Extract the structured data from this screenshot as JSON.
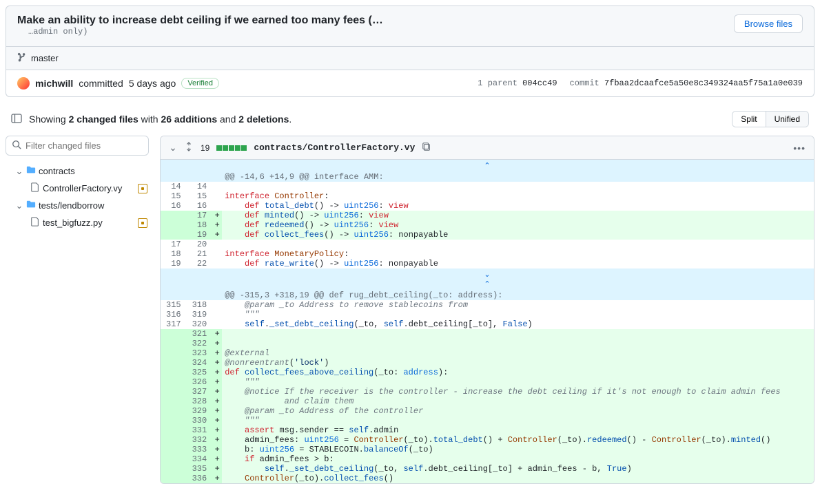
{
  "header": {
    "title": "Make an ability to increase debt ceiling if we earned too many fees (…",
    "subtitle": "…admin only)",
    "browse_files_label": "Browse files"
  },
  "branch": {
    "name": "master"
  },
  "commit": {
    "author": "michwill",
    "action": "committed",
    "when": "5 days ago",
    "verified_label": "Verified",
    "parent_count_label": "1 parent",
    "parent_sha": "004cc49",
    "commit_label": "commit",
    "commit_sha": "7fbaa2dcaafce5a50e8c349324aa5f75a1a0e039"
  },
  "stats": {
    "prefix": "Showing ",
    "files": "2 changed files",
    "with": " with ",
    "additions": "26 additions",
    "and": " and ",
    "deletions": "2 deletions",
    "suffix": "."
  },
  "view_toggle": {
    "split": "Split",
    "unified": "Unified"
  },
  "filter": {
    "placeholder": "Filter changed files"
  },
  "tree": {
    "folder1": "contracts",
    "file1": "ControllerFactory.vy",
    "folder2": "tests/lendborrow",
    "file2": "test_bigfuzz.py"
  },
  "file": {
    "count": "19",
    "name": "contracts/ControllerFactory.vy"
  },
  "diff_lines": [
    {
      "type": "expand-up"
    },
    {
      "type": "hunk",
      "old": "",
      "new": "",
      "text": "@@ -14,6 +14,9 @@ interface AMM:"
    },
    {
      "type": "ctx",
      "old": "14",
      "new": "14",
      "text": ""
    },
    {
      "type": "ctx",
      "old": "15",
      "new": "15",
      "html": "<span class='tok-k'>interface</span> <span class='tok-id'>Controller</span>:"
    },
    {
      "type": "ctx",
      "old": "16",
      "new": "16",
      "html": "    <span class='tok-k'>def</span> <span class='tok-fn'>total_debt</span>() -> <span class='tok-t'>uint256</span>: <span class='tok-k'>view</span>"
    },
    {
      "type": "add",
      "old": "",
      "new": "17",
      "html": "    <span class='tok-k'>def</span> <span class='tok-fn'>minted</span>() -> <span class='tok-t'>uint256</span>: <span class='tok-k'>view</span>"
    },
    {
      "type": "add",
      "old": "",
      "new": "18",
      "html": "    <span class='tok-k'>def</span> <span class='tok-fn'>redeemed</span>() -> <span class='tok-t'>uint256</span>: <span class='tok-k'>view</span>"
    },
    {
      "type": "add",
      "old": "",
      "new": "19",
      "html": "    <span class='tok-k'>def</span> <span class='tok-fn'>collect_fees</span>() -> <span class='tok-t'>uint256</span>: nonpayable"
    },
    {
      "type": "ctx",
      "old": "17",
      "new": "20",
      "text": ""
    },
    {
      "type": "ctx",
      "old": "18",
      "new": "21",
      "html": "<span class='tok-k'>interface</span> <span class='tok-id'>MonetaryPolicy</span>:"
    },
    {
      "type": "ctx",
      "old": "19",
      "new": "22",
      "html": "    <span class='tok-k'>def</span> <span class='tok-fn'>rate_write</span>() -> <span class='tok-t'>uint256</span>: nonpayable"
    },
    {
      "type": "expand-both"
    },
    {
      "type": "hunk",
      "old": "",
      "new": "",
      "text": "@@ -315,3 +318,19 @@ def rug_debt_ceiling(_to: address):"
    },
    {
      "type": "ctx",
      "old": "315",
      "new": "318",
      "html": "    <span class='tok-c'>@param _to Address to remove stablecoins from</span>"
    },
    {
      "type": "ctx",
      "old": "316",
      "new": "319",
      "html": "    <span class='tok-c'>\"\"\"</span>"
    },
    {
      "type": "ctx",
      "old": "317",
      "new": "320",
      "html": "    <span class='tok-b'>self</span>.<span class='tok-fn'>_set_debt_ceiling</span>(_to, <span class='tok-b'>self</span>.debt_ceiling[_to], <span class='tok-b'>False</span>)"
    },
    {
      "type": "add",
      "old": "",
      "new": "321",
      "text": ""
    },
    {
      "type": "add",
      "old": "",
      "new": "322",
      "text": ""
    },
    {
      "type": "add",
      "old": "",
      "new": "323",
      "html": "<span class='tok-c'>@external</span>"
    },
    {
      "type": "add",
      "old": "",
      "new": "324",
      "html": "<span class='tok-c'>@nonreentrant</span>(<span class='tok-s'>'lock'</span>)"
    },
    {
      "type": "add",
      "old": "",
      "new": "325",
      "html": "<span class='tok-k'>def</span> <span class='tok-fn'>collect_fees_above_ceiling</span>(_to: <span class='tok-t'>address</span>):"
    },
    {
      "type": "add",
      "old": "",
      "new": "326",
      "html": "    <span class='tok-c'>\"\"\"</span>"
    },
    {
      "type": "add",
      "old": "",
      "new": "327",
      "html": "    <span class='tok-c'>@notice If the receiver is the controller - increase the debt ceiling if it's not enough to claim admin fees</span>"
    },
    {
      "type": "add",
      "old": "",
      "new": "328",
      "html": "    <span class='tok-c'>        and claim them</span>"
    },
    {
      "type": "add",
      "old": "",
      "new": "329",
      "html": "    <span class='tok-c'>@param _to Address of the controller</span>"
    },
    {
      "type": "add",
      "old": "",
      "new": "330",
      "html": "    <span class='tok-c'>\"\"\"</span>"
    },
    {
      "type": "add",
      "old": "",
      "new": "331",
      "html": "    <span class='tok-k'>assert</span> msg.sender == <span class='tok-b'>self</span>.admin"
    },
    {
      "type": "add",
      "old": "",
      "new": "332",
      "html": "    admin_fees: <span class='tok-t'>uint256</span> = <span class='tok-id'>Controller</span>(_to).<span class='tok-fn'>total_debt</span>() + <span class='tok-id'>Controller</span>(_to).<span class='tok-fn'>redeemed</span>() - <span class='tok-id'>Controller</span>(_to).<span class='tok-fn'>minted</span>()"
    },
    {
      "type": "add",
      "old": "",
      "new": "333",
      "html": "    b: <span class='tok-t'>uint256</span> = STABLECOIN.<span class='tok-fn'>balanceOf</span>(_to)"
    },
    {
      "type": "add",
      "old": "",
      "new": "334",
      "html": "    <span class='tok-k'>if</span> admin_fees > b:"
    },
    {
      "type": "add",
      "old": "",
      "new": "335",
      "html": "        <span class='tok-b'>self</span>.<span class='tok-fn'>_set_debt_ceiling</span>(_to, <span class='tok-b'>self</span>.debt_ceiling[_to] + admin_fees - b, <span class='tok-b'>True</span>)"
    },
    {
      "type": "add",
      "old": "",
      "new": "336",
      "html": "    <span class='tok-id'>Controller</span>(_to).<span class='tok-fn'>collect_fees</span>()"
    }
  ]
}
